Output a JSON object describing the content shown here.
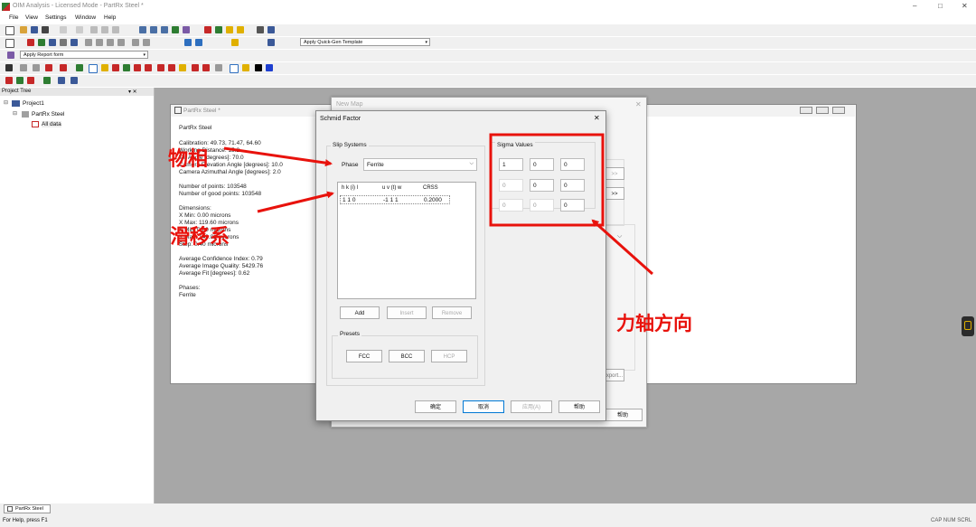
{
  "window": {
    "title": "OIM Analysis - Licensed Mode - PartRx Steel *",
    "controls": [
      "–",
      "□",
      "✕"
    ]
  },
  "menu": [
    "File",
    "View",
    "Settings",
    "Window",
    "Help"
  ],
  "toolbar": {
    "quick_gen_template": "Apply Quick-Gen Template",
    "report_form": "Apply Report form"
  },
  "project_tree": {
    "header": "Project Tree",
    "header_controls": "▾ ✕",
    "items": [
      "Project1",
      "PartRx Steel",
      "All data"
    ]
  },
  "document": {
    "title": "PartRx Steel *",
    "name": "PartRx Steel",
    "lines": [
      "Calibration: 49.73, 71.47, 64.60",
      "Working Distance: 15.2",
      "Tilt Angle [degrees]: 70.0",
      "Camera Elevation Angle [degrees]: 10.0",
      "Camera Azimuthal Angle [degrees]: 2.0",
      "",
      "Number of points: 103548",
      "Number of good points: 103548",
      "",
      "Dimensions:",
      "X Min: 0.00 microns",
      "X Max: 119.60 microns",
      "Y Min: 0.00 microns",
      "Y Max: 149.81 microns",
      "Step: 0.40 microns",
      "",
      "Average Confidence Index: 0.79",
      "Average Image Quality: 5429.76",
      "Average Fit [degrees]: 0.62",
      "",
      "Phases:",
      "Ferrite"
    ]
  },
  "new_map": {
    "title": "New Map",
    "arrow_buttons": [
      ">>",
      ">>"
    ],
    "export_label": "Export...",
    "help_label": "帮助"
  },
  "schmid": {
    "title": "Schmid Factor",
    "slip_systems_label": "Slip Systems",
    "phase_label": "Phase",
    "phase_value": "Ferrite",
    "table_headers": [
      "h k (i) l",
      "u v (t) w",
      "CRSS"
    ],
    "table_rows": [
      [
        "1 1 0",
        "-1 1 1",
        "0.2000"
      ]
    ],
    "add_label": "Add",
    "insert_label": "Insert",
    "remove_label": "Remove",
    "presets_label": "Presets",
    "presets": [
      "FCC",
      "BCC",
      "HCP"
    ],
    "sigma_label": "Sigma Values",
    "sigma": [
      [
        "1",
        "0",
        "0"
      ],
      [
        "0",
        "0",
        "0"
      ],
      [
        "0",
        "0",
        "0"
      ]
    ],
    "ok_label": "确定",
    "cancel_label": "取消",
    "apply_label": "应用(A)",
    "help_label": "帮助"
  },
  "annotations": {
    "phase": "物相",
    "slip": "滑移系",
    "axis": "力轴方向",
    "color": "#e8120c"
  },
  "taskbar": {
    "tab": "PartRx Steel"
  },
  "status": {
    "left": "For Help, press F1",
    "right": "CAP  NUM  SCRL"
  }
}
